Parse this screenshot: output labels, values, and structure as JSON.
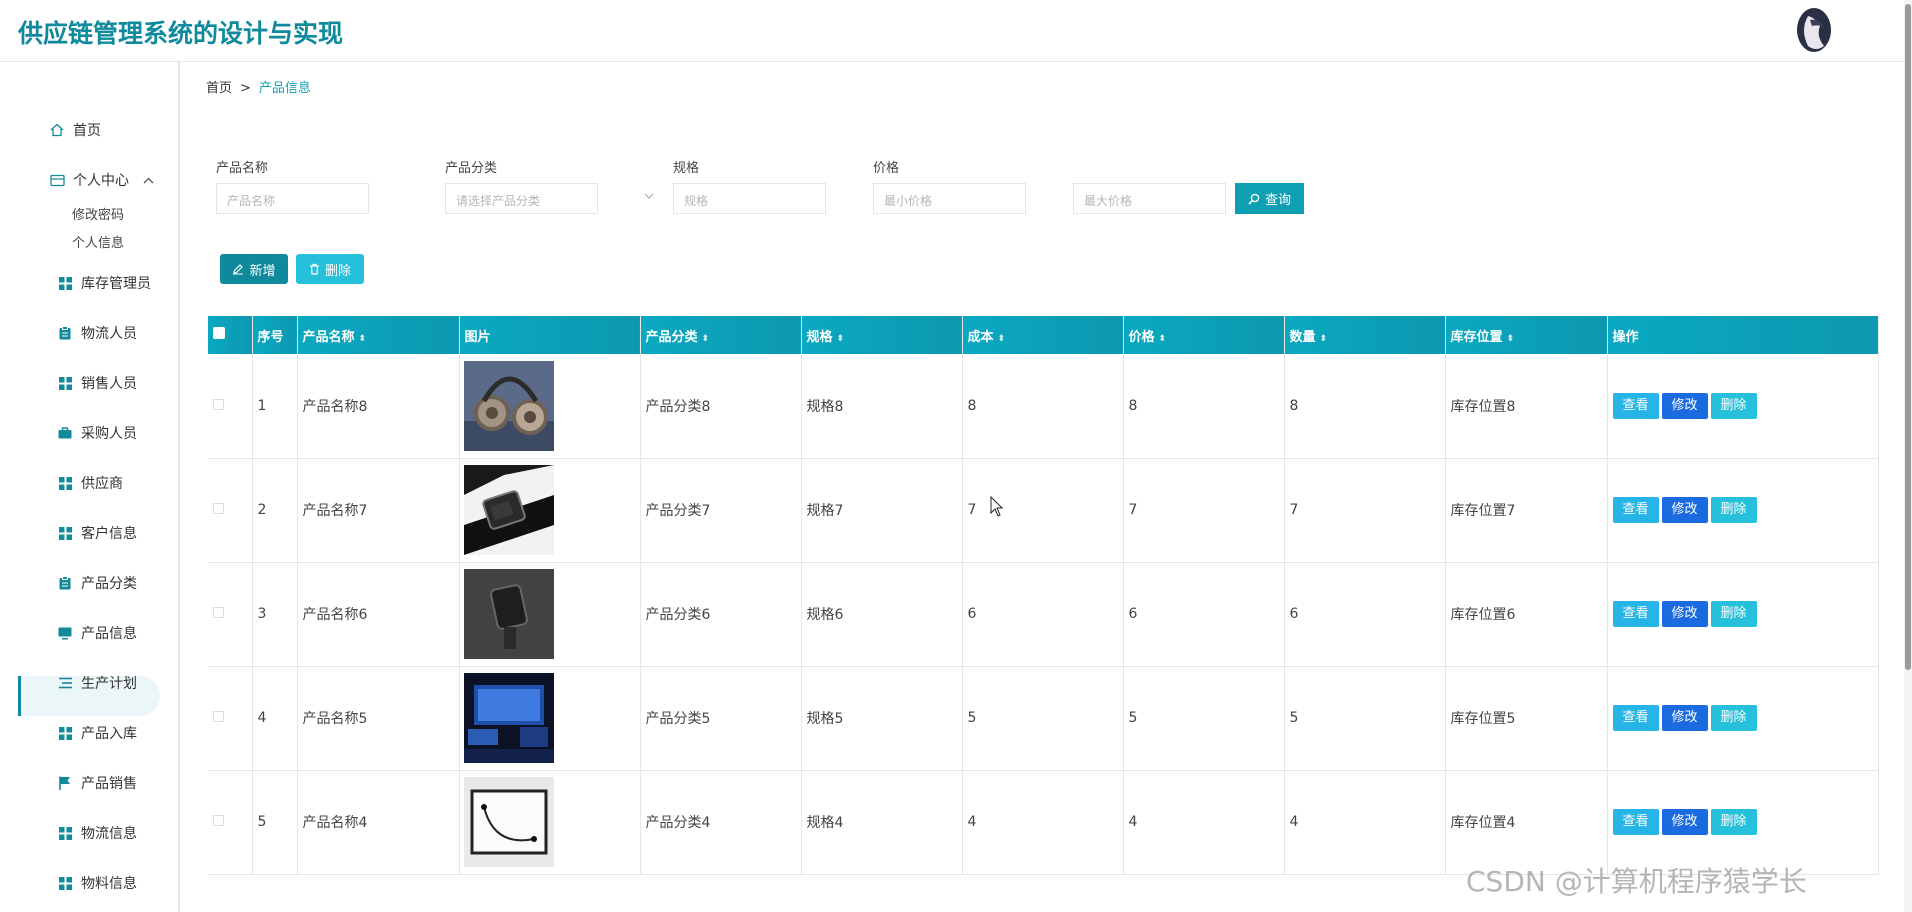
{
  "header": {
    "title": "供应链管理系统的设计与实现"
  },
  "breadcrumb": {
    "home": "首页",
    "sep": ">",
    "current": "产品信息"
  },
  "sidebar": {
    "home": "首页",
    "personal_center": "个人中心",
    "personal_sub": [
      "修改密码",
      "个人信息"
    ],
    "items": [
      {
        "label": "库存管理员",
        "icon": "grid-icon"
      },
      {
        "label": "物流人员",
        "icon": "clipboard-icon"
      },
      {
        "label": "销售人员",
        "icon": "grid-icon"
      },
      {
        "label": "采购人员",
        "icon": "briefcase-icon"
      },
      {
        "label": "供应商",
        "icon": "grid-icon"
      },
      {
        "label": "客户信息",
        "icon": "grid-icon"
      },
      {
        "label": "产品分类",
        "icon": "clipboard-icon"
      },
      {
        "label": "产品信息",
        "icon": "monitor-icon"
      },
      {
        "label": "生产计划",
        "icon": "list-icon"
      },
      {
        "label": "产品入库",
        "icon": "grid-icon"
      },
      {
        "label": "产品销售",
        "icon": "flag-icon"
      },
      {
        "label": "物流信息",
        "icon": "grid-icon"
      },
      {
        "label": "物料信息",
        "icon": "grid-icon"
      }
    ]
  },
  "filters": {
    "name_label": "产品名称",
    "name_placeholder": "产品名称",
    "category_label": "产品分类",
    "category_placeholder": "请选择产品分类",
    "spec_label": "规格",
    "spec_placeholder": "规格",
    "price_label": "价格",
    "min_price_placeholder": "最小价格",
    "max_price_placeholder": "最大价格",
    "query_button": "查询"
  },
  "toolbar": {
    "add_button": "新增",
    "delete_button": "删除"
  },
  "table": {
    "columns": [
      "序号",
      "产品名称",
      "图片",
      "产品分类",
      "规格",
      "成本",
      "价格",
      "数量",
      "库存位置",
      "操作"
    ],
    "rows": [
      {
        "index": "1",
        "name": "产品名称8",
        "category": "产品分类8",
        "spec": "规格8",
        "cost": "8",
        "price": "8",
        "qty": "8",
        "location": "库存位置8"
      },
      {
        "index": "2",
        "name": "产品名称7",
        "category": "产品分类7",
        "spec": "规格7",
        "cost": "7",
        "price": "7",
        "qty": "7",
        "location": "库存位置7"
      },
      {
        "index": "3",
        "name": "产品名称6",
        "category": "产品分类6",
        "spec": "规格6",
        "cost": "6",
        "price": "6",
        "qty": "6",
        "location": "库存位置6"
      },
      {
        "index": "4",
        "name": "产品名称5",
        "category": "产品分类5",
        "spec": "规格5",
        "cost": "5",
        "price": "5",
        "qty": "5",
        "location": "库存位置5"
      },
      {
        "index": "5",
        "name": "产品名称4",
        "category": "产品分类4",
        "spec": "规格4",
        "cost": "4",
        "price": "4",
        "qty": "4",
        "location": "库存位置4"
      }
    ],
    "actions": {
      "view": "查看",
      "edit": "修改",
      "delete": "删除"
    }
  },
  "watermark": "CSDN @计算机程序猿学长",
  "colors": {
    "accent": "#0f8a9d",
    "header_bg": "#0aa9c1",
    "view_btn": "#27b4e6",
    "edit_btn": "#1a6be0",
    "delete_btn": "#27c0db"
  }
}
